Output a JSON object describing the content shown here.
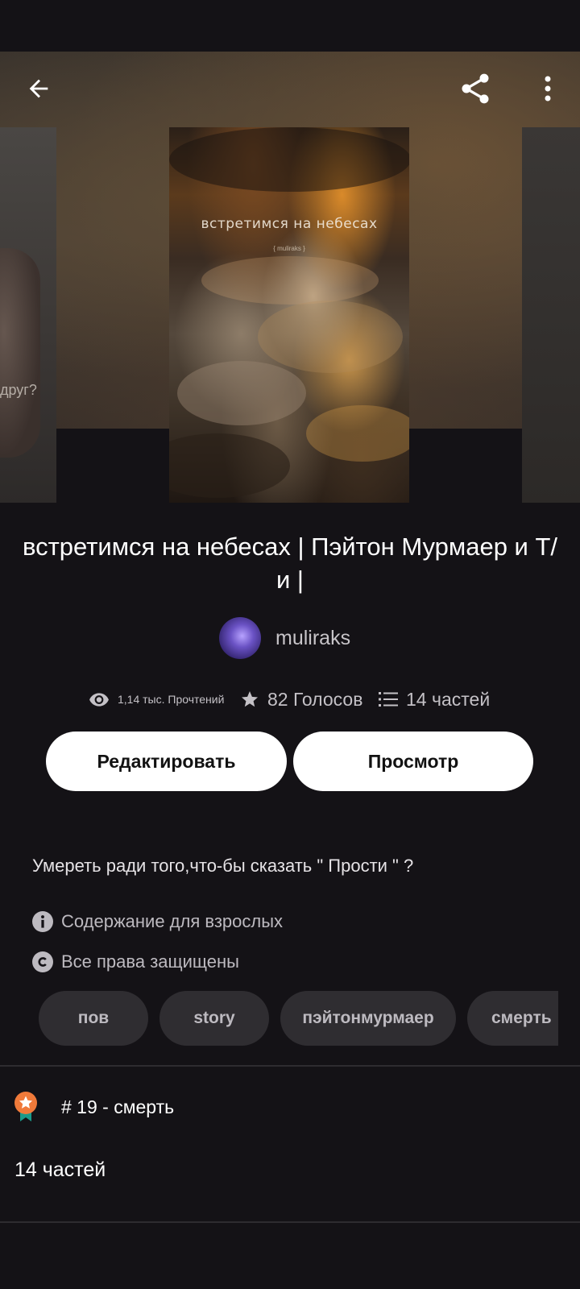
{
  "header": {
    "back_icon": "arrow-left-icon",
    "share_icon": "share-icon",
    "more_icon": "more-vertical-icon"
  },
  "covers": {
    "main_title": "встретимся на небесах",
    "main_subtitle": "{ muliraks }",
    "left_partial_text": "друг?"
  },
  "story": {
    "title": "встретимся на небесах | Пэйтон Мурмаер и Т/и |",
    "author": "muliraks",
    "stats": {
      "reads": "1,14 тыс. Прочтений",
      "votes": "82 Голосов",
      "parts": "14 частей"
    },
    "buttons": {
      "edit": "Редактировать",
      "view": "Просмотр"
    },
    "description": "Умереть ради того,что-бы сказать \" Прости \" ?",
    "mature_label": "Содержание для взрослых",
    "rights_label": "Все права защищены",
    "tags": [
      "пов",
      "story",
      "пэйтонмурмаер",
      "смерть"
    ],
    "ranking": "# 19 - смерть",
    "parts_count": "14 частей"
  },
  "colors": {
    "background": "#141216",
    "button_bg": "#ffffff",
    "tag_bg": "#2f2d31",
    "badge_orange": "#f07a3a",
    "badge_teal": "#1a9a8a"
  }
}
